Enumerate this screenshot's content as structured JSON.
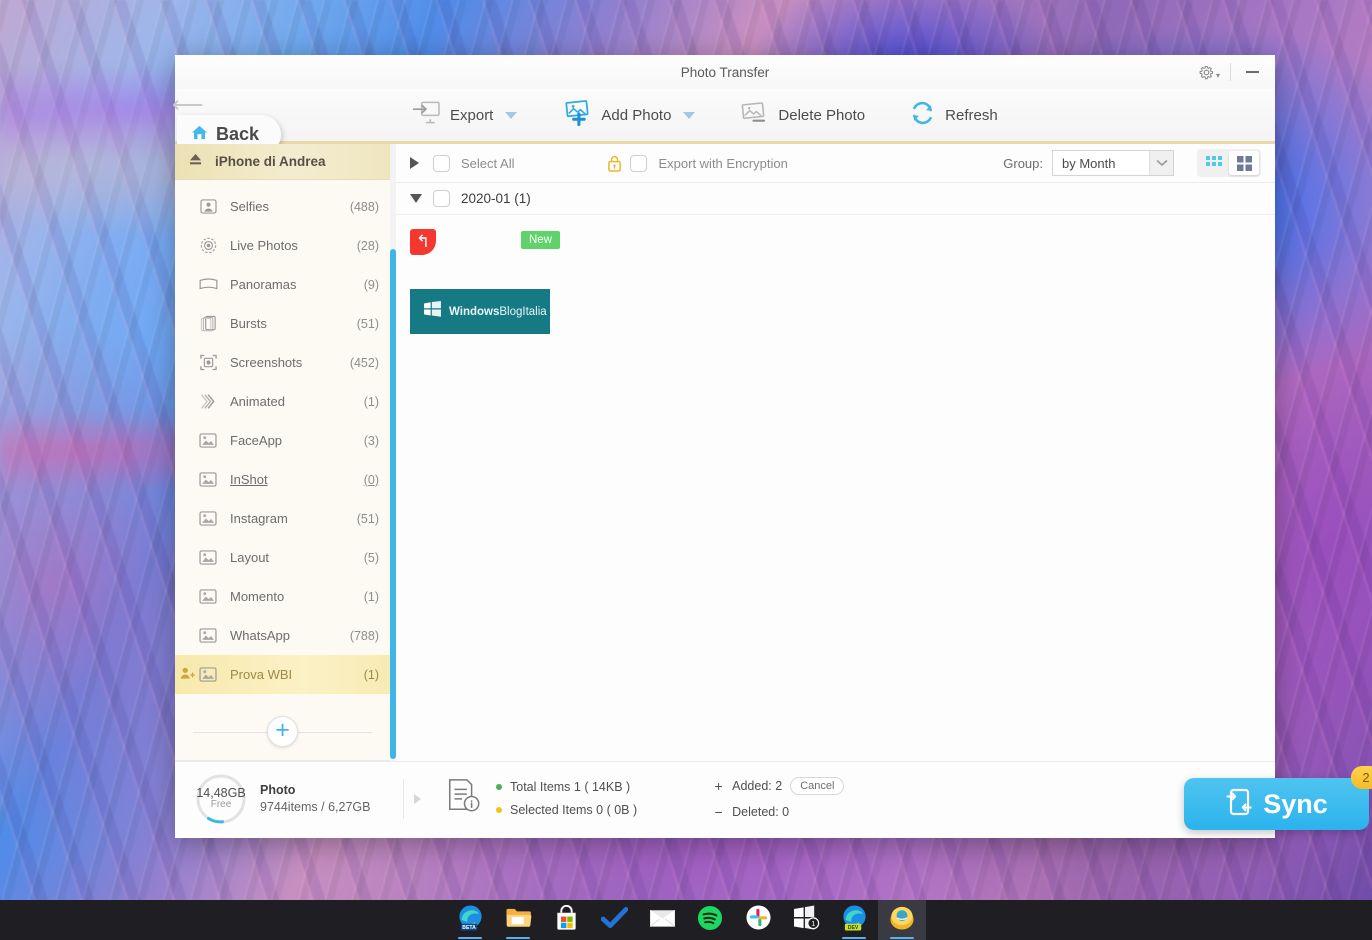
{
  "window": {
    "title": "Photo Transfer",
    "gear_icon": "gear-icon",
    "minimize_icon": "minimize-icon"
  },
  "toolbar": {
    "back_label": "Back",
    "back_icon": "home-icon",
    "items": [
      {
        "label": "Export",
        "icon": "export-to-computer-icon",
        "has_caret": true
      },
      {
        "label": "Add Photo",
        "icon": "add-photo-icon",
        "has_caret": true
      },
      {
        "label": "Delete Photo",
        "icon": "delete-photo-icon",
        "has_caret": false
      },
      {
        "label": "Refresh",
        "icon": "refresh-icon",
        "has_caret": false
      }
    ]
  },
  "sidebar": {
    "device": {
      "name": "iPhone di Andrea",
      "icon": "eject-icon"
    },
    "categories": [
      {
        "label": "Selfies",
        "count": "(488)",
        "icon": "person-frame-icon",
        "active": false,
        "underline": false
      },
      {
        "label": "Live Photos",
        "count": "(28)",
        "icon": "live-photo-icon",
        "active": false,
        "underline": false
      },
      {
        "label": "Panoramas",
        "count": "(9)",
        "icon": "panorama-icon",
        "active": false,
        "underline": false
      },
      {
        "label": "Bursts",
        "count": "(51)",
        "icon": "burst-icon",
        "active": false,
        "underline": false
      },
      {
        "label": "Screenshots",
        "count": "(452)",
        "icon": "screenshot-icon",
        "active": false,
        "underline": false
      },
      {
        "label": "Animated",
        "count": "(1)",
        "icon": "animated-icon",
        "active": false,
        "underline": false
      },
      {
        "label": "FaceApp",
        "count": "(3)",
        "icon": "album-icon",
        "active": false,
        "underline": false
      },
      {
        "label": "InShot",
        "count": "(0)",
        "icon": "album-icon",
        "active": false,
        "underline": true
      },
      {
        "label": "Instagram",
        "count": "(51)",
        "icon": "album-icon",
        "active": false,
        "underline": false
      },
      {
        "label": "Layout",
        "count": "(5)",
        "icon": "album-icon",
        "active": false,
        "underline": false
      },
      {
        "label": "Momento",
        "count": "(1)",
        "icon": "album-icon",
        "active": false,
        "underline": false
      },
      {
        "label": "WhatsApp",
        "count": "(788)",
        "icon": "album-icon",
        "active": false,
        "underline": false
      },
      {
        "label": "Prova WBI",
        "count": "(1)",
        "icon": "album-icon",
        "active": true,
        "underline": false
      }
    ],
    "add_album_icon": "plus-icon"
  },
  "content_bar": {
    "expand_icon": "triangle-right-icon",
    "select_all_label": "Select All",
    "lock_icon": "lock-icon",
    "encryption_label": "Export with Encryption",
    "group_label": "Group:",
    "group_value": "by Month",
    "view_small_icon": "grid-small-icon",
    "view_large_icon": "grid-large-icon"
  },
  "photo_group": {
    "collapse_icon": "triangle-down-icon",
    "title": "2020-01  (1)"
  },
  "photos": [
    {
      "undo_icon": "undo-icon",
      "badge": "New",
      "tile_icon": "windows-logo-icon",
      "tile_text_prefix": "Windows",
      "tile_text_suffix": "BlogItalia"
    }
  ],
  "status": {
    "storage_free_value": "14,48GB",
    "storage_free_label": "Free",
    "storage_kind": "Photo",
    "storage_detail": "9744items / 6,27GB",
    "info_icon": "document-info-icon",
    "total_items": "Total Items 1  ( 14KB )",
    "selected_items": "Selected Items 0  ( 0B )",
    "total_dot_color": "#4caf50",
    "selected_dot_color": "#f0c419",
    "added_label": "Added: 2",
    "deleted_label": "Deleted: 0",
    "cancel_label": "Cancel",
    "sync_label": "Sync",
    "sync_icon": "sync-device-icon",
    "sync_badge": "2"
  },
  "taskbar": {
    "apps": [
      {
        "name": "edge-beta",
        "active": false,
        "running": true,
        "badge": ""
      },
      {
        "name": "file-explorer",
        "active": false,
        "running": true,
        "badge": ""
      },
      {
        "name": "microsoft-store",
        "active": false,
        "running": false,
        "badge": ""
      },
      {
        "name": "microsoft-todo",
        "active": false,
        "running": false,
        "badge": ""
      },
      {
        "name": "mail",
        "active": false,
        "running": false,
        "badge": ""
      },
      {
        "name": "spotify",
        "active": false,
        "running": false,
        "badge": ""
      },
      {
        "name": "slack",
        "active": false,
        "running": false,
        "badge": ""
      },
      {
        "name": "your-phone",
        "active": false,
        "running": false,
        "badge": "1"
      },
      {
        "name": "edge-dev",
        "active": false,
        "running": true,
        "badge": ""
      },
      {
        "name": "photo-transfer",
        "active": true,
        "running": true,
        "badge": ""
      }
    ]
  },
  "colors": {
    "accent_blue": "#3fb6e6",
    "highlight_gold": "#f7e9ac",
    "tile_teal": "#157a84",
    "badge_green": "#5fd36a",
    "badge_red": "#f4372f",
    "badge_yellow": "#f6bc27"
  }
}
